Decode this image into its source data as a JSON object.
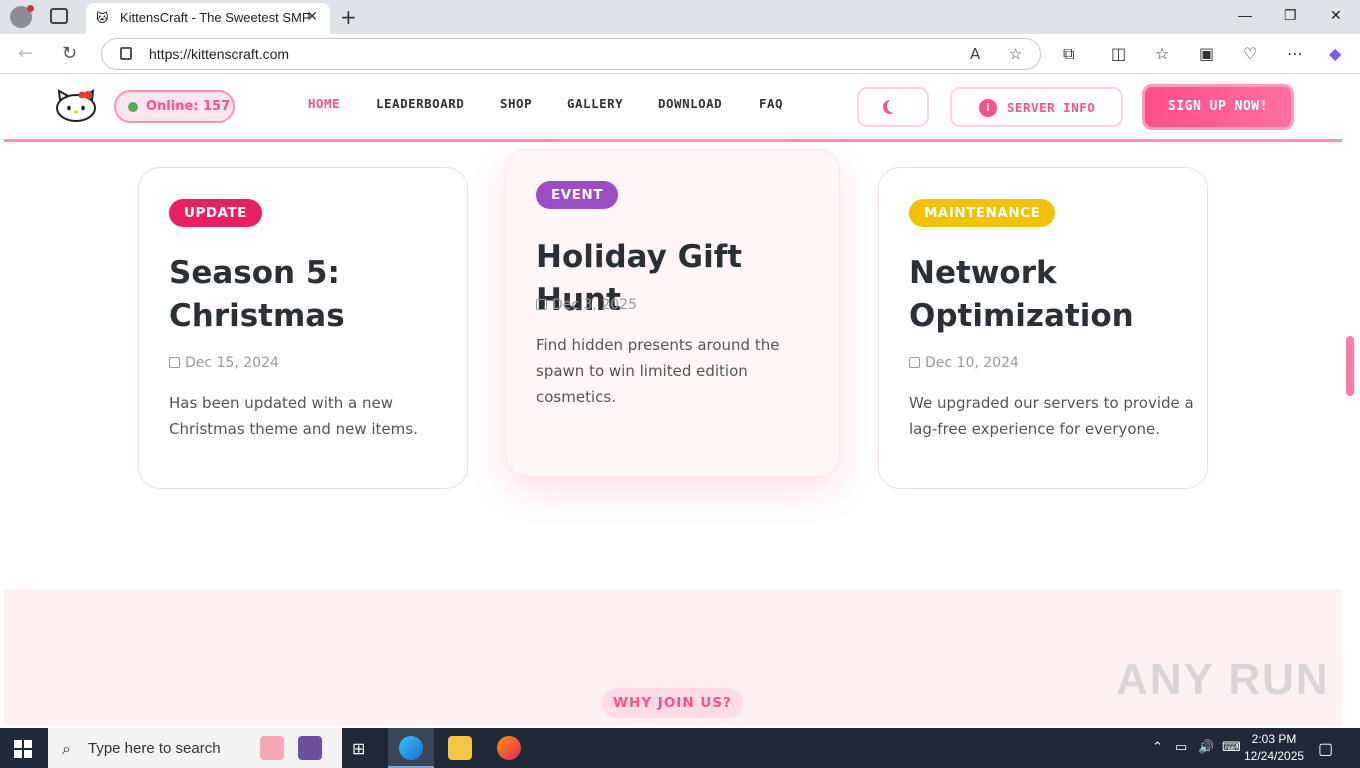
{
  "browser": {
    "tab_title": "KittensCraft - The Sweetest SMP",
    "url": "https://kittenscraft.com",
    "new_tab_symbol": "+",
    "tab_close_symbol": "✕",
    "window_controls": {
      "minimize": "—",
      "restore": "❐",
      "close": "✕"
    },
    "toolbar_icons": [
      "read-aloud-icon",
      "favorite-star-icon",
      "extensions-icon",
      "split-screen-icon",
      "favorites-icon",
      "collections-icon",
      "browser-essentials-icon",
      "more-icon",
      "copilot-icon"
    ]
  },
  "site": {
    "online_label": "Online: 157",
    "nav": [
      {
        "label": "HOME",
        "active": true
      },
      {
        "label": "LEADERBOARD"
      },
      {
        "label": "SHOP"
      },
      {
        "label": "GALLERY"
      },
      {
        "label": "DOWNLOAD"
      },
      {
        "label": "FAQ"
      }
    ],
    "server_info_label": "SERVER INFO",
    "signup_label": "SIGN UP NOW!",
    "colors": {
      "primary": "#ff4f8b",
      "update": "#e91e63",
      "event": "#9c4dc4",
      "maintenance": "#f2c200"
    }
  },
  "news": [
    {
      "badge": "UPDATE",
      "title": "Season 5: Christmas",
      "date": "Dec 15, 2024",
      "text": "Has been updated with a new Christmas theme and new items."
    },
    {
      "badge": "EVENT",
      "title": "Holiday Gift Hunt",
      "date": "Dec 3, 2025",
      "text": "Find hidden presents around the spawn to win limited edition cosmetics."
    },
    {
      "badge": "MAINTENANCE",
      "title": "Network Optimization",
      "date": "Dec 10, 2024",
      "text": "We upgraded our servers to provide a lag-free experience for everyone."
    }
  ],
  "why_join": "WHY JOIN US?",
  "watermark": "ANY RUN",
  "taskbar": {
    "search_placeholder": "Type here to search",
    "time": "2:03 PM",
    "date": "12/24/2025"
  }
}
